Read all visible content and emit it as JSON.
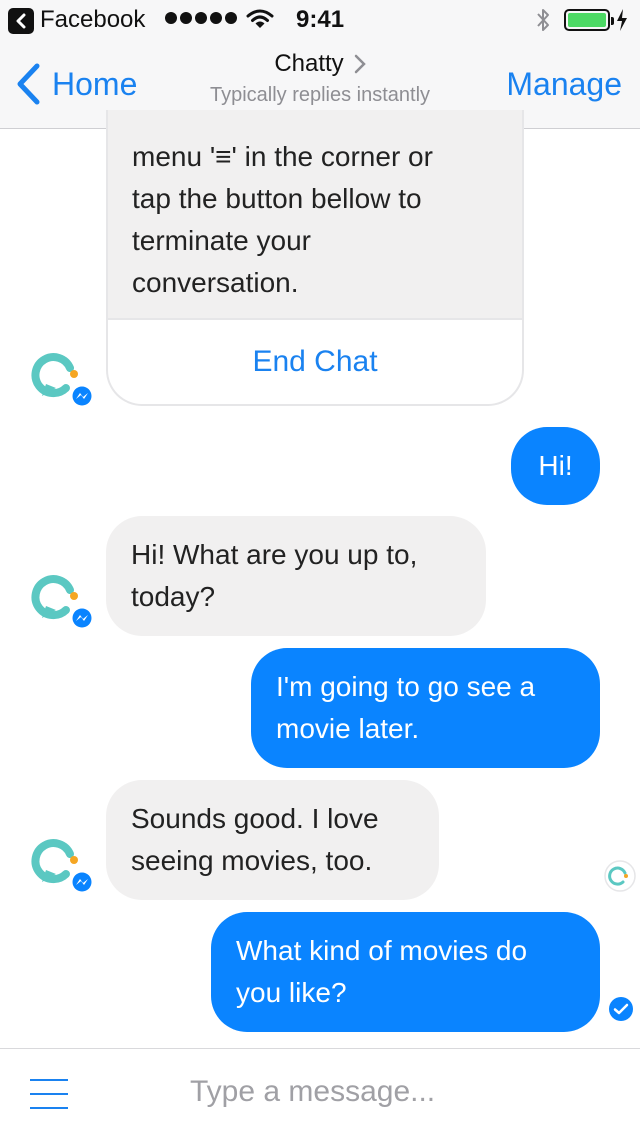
{
  "status_bar": {
    "back_app": "Facebook",
    "time": "9:41"
  },
  "nav": {
    "back_label": "Home",
    "title": "Chatty",
    "subtitle": "Typically replies instantly",
    "manage_label": "Manage"
  },
  "conversation": {
    "card_text": "menu '≡' in the corner or\ntap the button bellow to\nterminate your\nconversation.",
    "card_button": "End Chat",
    "messages": [
      {
        "from": "user",
        "text": "Hi!"
      },
      {
        "from": "bot",
        "text": "Hi! What are you up to, today?"
      },
      {
        "from": "user",
        "text": "I'm going to go see a movie later."
      },
      {
        "from": "bot",
        "text": "Sounds good. I love seeing movies, too."
      },
      {
        "from": "user",
        "text": "What kind of movies do you like?"
      }
    ]
  },
  "composer": {
    "placeholder": "Type a message..."
  },
  "colors": {
    "accent": "#1a82f0",
    "outgoing_bubble": "#0a84ff",
    "incoming_bubble": "#f1f0f0",
    "bot_logo": "#5bc8c2",
    "bot_logo_dot": "#f5a623",
    "battery": "#4cd964"
  },
  "icons": [
    "back-chevron-icon",
    "signal-dots-icon",
    "wifi-icon",
    "bluetooth-icon",
    "battery-icon",
    "charging-bolt-icon",
    "chevron-right-icon",
    "bot-avatar-icon",
    "messenger-badge-icon",
    "seen-avatar-icon",
    "delivered-check-icon",
    "menu-icon"
  ]
}
